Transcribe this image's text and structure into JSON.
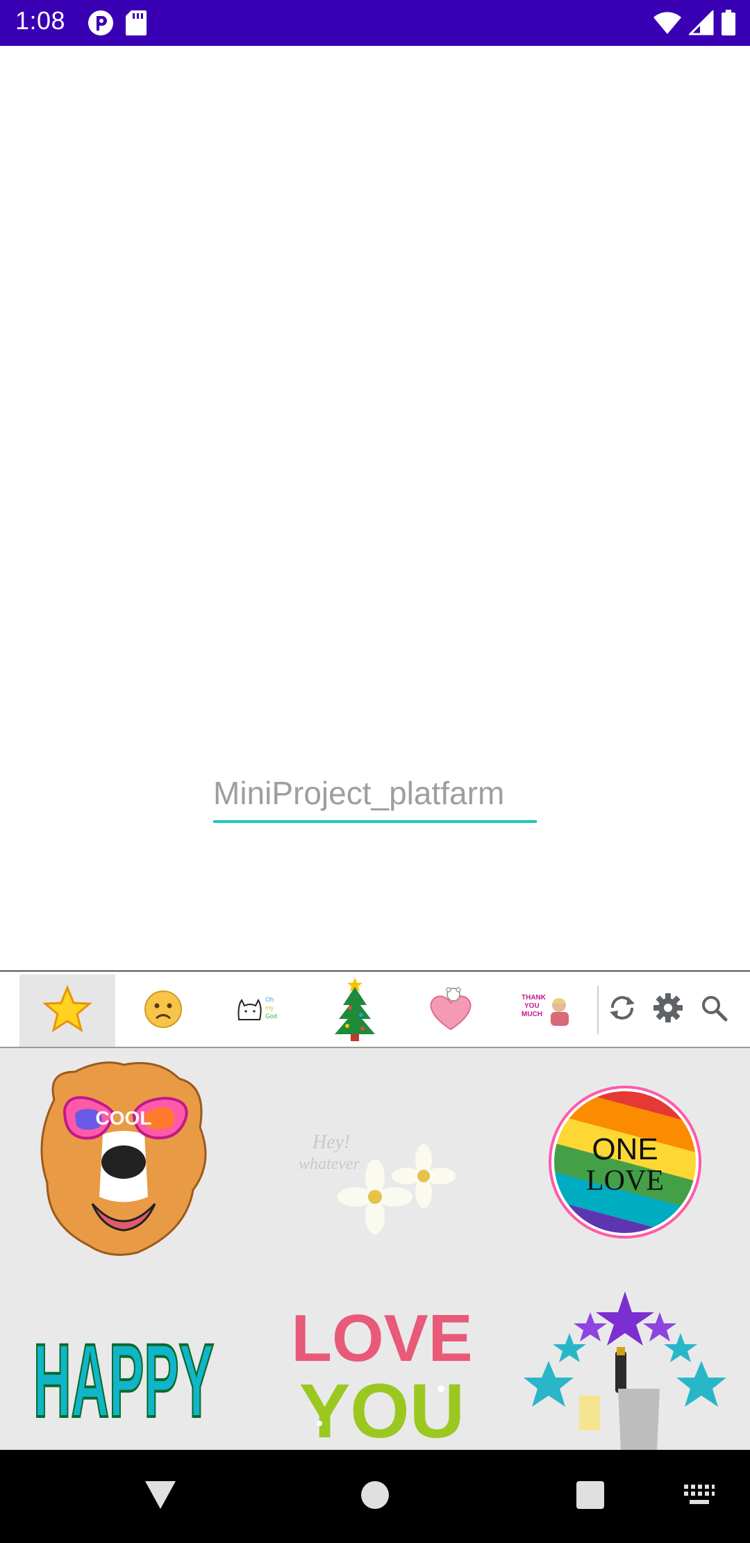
{
  "status_bar": {
    "time": "1:08"
  },
  "editor": {
    "text_value": "MiniProject_platfarm",
    "accent_color": "#1ec8b4"
  },
  "keyboard": {
    "tabs": [
      {
        "name": "favorites",
        "icon": "star-icon"
      },
      {
        "name": "sad",
        "icon": "sad-face-icon"
      },
      {
        "name": "cat",
        "icon": "cat-doodle-icon"
      },
      {
        "name": "christmas",
        "icon": "christmas-tree-icon"
      },
      {
        "name": "love",
        "icon": "heart-bear-icon"
      },
      {
        "name": "thank-you",
        "icon": "thank-you-icon"
      }
    ],
    "actions": [
      "refresh-icon",
      "settings-icon",
      "search-icon"
    ],
    "stickers": [
      {
        "name": "dog-sunglasses-sticker",
        "text": "COOL"
      },
      {
        "name": "flower-sticker",
        "text": ""
      },
      {
        "name": "one-love-sticker",
        "text": "ONE LOVE"
      },
      {
        "name": "happy-sticker",
        "text": "HAPPY"
      },
      {
        "name": "love-you-sticker",
        "text": "LOVE YOU"
      },
      {
        "name": "champagne-stars-sticker",
        "text": ""
      }
    ]
  },
  "colors": {
    "status_bar": "#3a00b3",
    "keyboard_bg": "#e9e9e9"
  }
}
